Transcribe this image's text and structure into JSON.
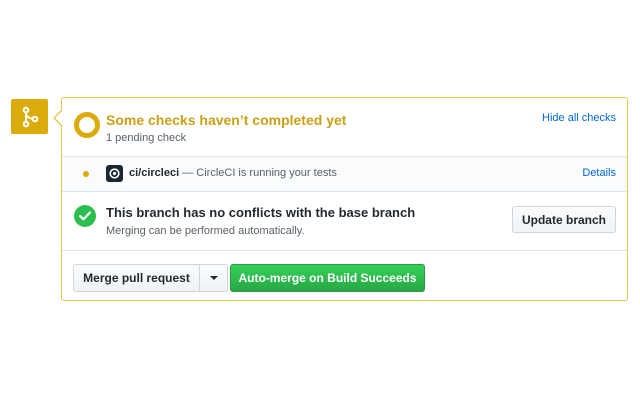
{
  "status": {
    "title": "Some checks haven’t completed yet",
    "subtitle": "1 pending check",
    "toggle_label": "Hide all checks",
    "status_color": "#dbab09"
  },
  "checks": [
    {
      "name": "ci/circleci",
      "description": " — CircleCI is running your tests",
      "link_label": "Details",
      "state": "pending"
    }
  ],
  "merge_status": {
    "title": "This branch has no conflicts with the base branch",
    "subtitle": "Merging can be performed automatically.",
    "update_label": "Update branch",
    "success_color": "#2cbe4e"
  },
  "actions": {
    "merge_label": "Merge pull request",
    "auto_merge_label": "Auto-merge on Build Succeeds"
  },
  "icons": {
    "merge": "git-merge-icon",
    "pending": "pending-ring-icon",
    "success": "check-icon",
    "ci": "circleci-icon",
    "dropdown": "triangle-down-icon"
  }
}
